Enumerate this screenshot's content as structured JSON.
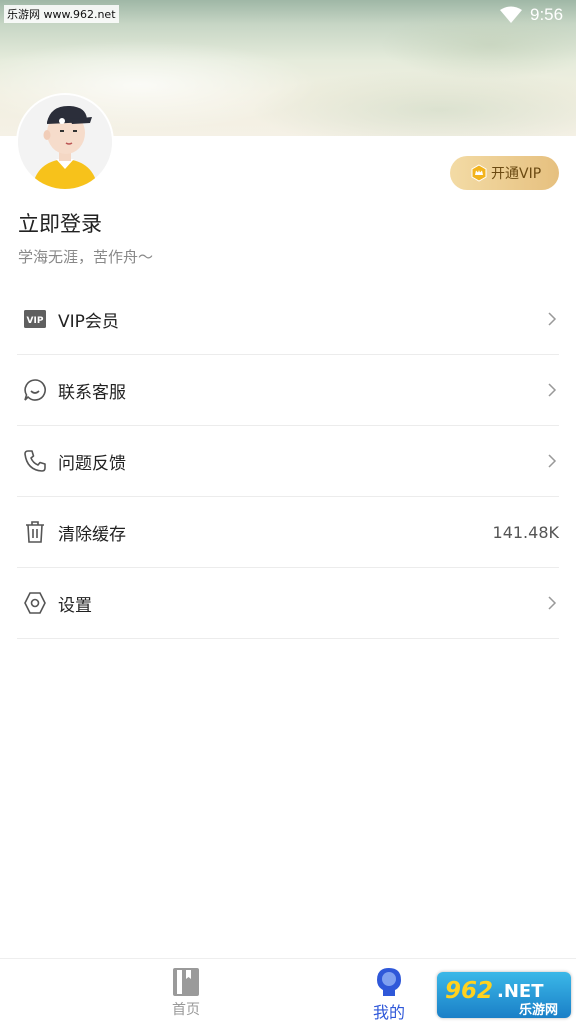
{
  "status_bar": {
    "site_text": "乐游网 www.962.net",
    "time": "9:56"
  },
  "profile": {
    "vip_button_label": "开通VIP",
    "login_title": "立即登录",
    "motto": "学海无涯，苦作舟～"
  },
  "menu": {
    "items": [
      {
        "label": "VIP会员",
        "icon": "vip-icon"
      },
      {
        "label": "联系客服",
        "icon": "chat-bubble-icon"
      },
      {
        "label": "问题反馈",
        "icon": "phone-icon"
      },
      {
        "label": "清除缓存",
        "icon": "trash-icon",
        "value": "141.48K"
      },
      {
        "label": "设置",
        "icon": "hexagon-settings-icon"
      }
    ]
  },
  "bottom_nav": {
    "home_label": "首页",
    "mine_label": "我的",
    "active_color": "#2f58d9"
  },
  "watermark": {
    "logo_text": "962.NET",
    "sub_text": "乐游网"
  }
}
